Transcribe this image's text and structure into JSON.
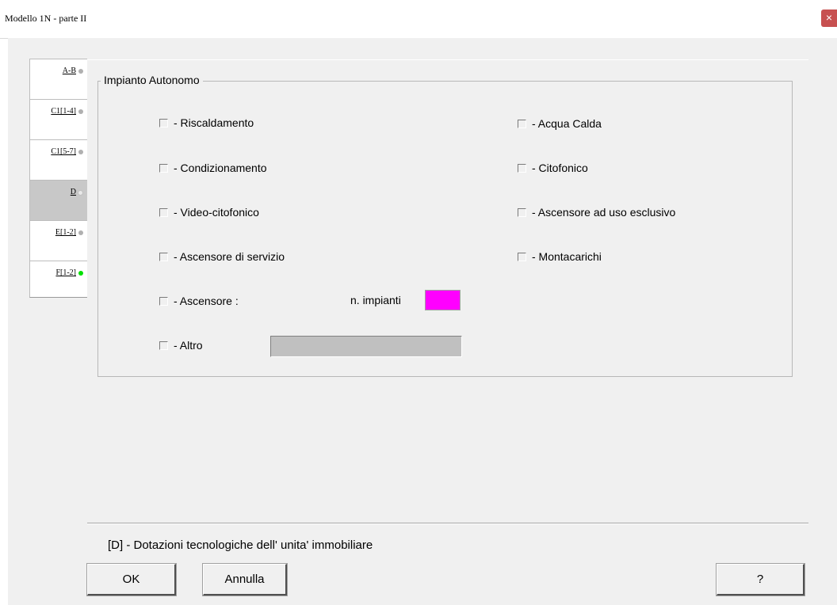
{
  "window": {
    "title": "Modello 1N  -   parte II",
    "close_label": "×"
  },
  "tabs": [
    {
      "label": "A-B",
      "status": "grey"
    },
    {
      "label": "C1[1-4]",
      "status": "grey"
    },
    {
      "label": "C1[5-7]",
      "status": "grey"
    },
    {
      "label": "D",
      "status": "white",
      "active": true
    },
    {
      "label": "E[1-2]",
      "status": "grey"
    },
    {
      "label": "F[1-2]",
      "status": "green"
    }
  ],
  "group": {
    "title": "Impianto Autonomo",
    "left_options": [
      "- Riscaldamento",
      "- Condizionamento",
      "- Video-citofonico",
      "- Ascensore di servizio",
      "- Ascensore :",
      "- Altro"
    ],
    "right_options": [
      "- Acqua Calda",
      "- Citofonico",
      "- Ascensore ad uso esclusivo",
      "- Montacarichi"
    ],
    "n_impianti_label": "n. impianti",
    "n_impianti_value": "",
    "altro_value": ""
  },
  "footer": {
    "description": "[D] - Dotazioni tecnologiche dell' unita' immobiliare",
    "ok_label": "OK",
    "cancel_label": "Annulla",
    "help_label": "?"
  },
  "colors": {
    "n_impianti_bg": "#ff00ff",
    "altro_bg": "#c0c0c0",
    "status_green": "#00e000"
  }
}
